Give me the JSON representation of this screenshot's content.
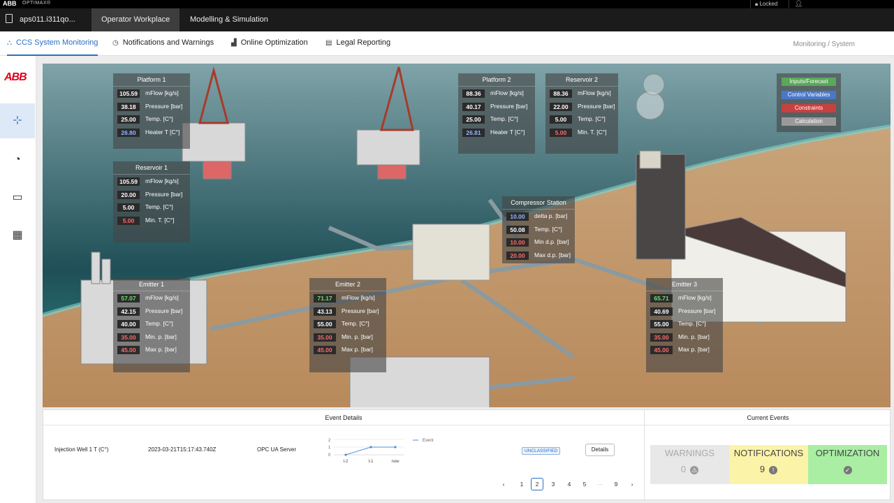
{
  "topbar": {
    "brand": "ABB",
    "app": "OPTIMAX®",
    "lock_label": "Locked"
  },
  "nav": {
    "doc_label": "aps011.i311qo...",
    "items": [
      "Operator Workplace",
      "Modelling & Simulation"
    ]
  },
  "tabs": [
    "CCS System Monitoring",
    "Notifications and Warnings",
    "Online Optimization",
    "Legal Reporting"
  ],
  "breadcrumb": "Monitoring  /  System",
  "sidebar": {
    "logo": "ABB",
    "icons": [
      "network-icon",
      "pie-chart-icon",
      "monitor-icon",
      "grid-icon"
    ]
  },
  "legend": [
    "Inputs/Forecast",
    "Control Variables",
    "Constraints",
    "Calculation"
  ],
  "legend_colors": [
    "#5aa85a",
    "#4a78c8",
    "#c84040",
    "#9a9a9a"
  ],
  "panels": {
    "platform1": {
      "title": "Platform 1",
      "rows": [
        [
          "105.59",
          "mFlow [kg/s]",
          ""
        ],
        [
          "38.18",
          "Pressure [bar]",
          ""
        ],
        [
          "25.00",
          "Temp. [C°]",
          ""
        ],
        [
          "26.80",
          "Heater T [C°]",
          "blue"
        ]
      ]
    },
    "reservoir1": {
      "title": "Reservoir 1",
      "rows": [
        [
          "105.59",
          "mFlow [kg/s]",
          ""
        ],
        [
          "20.00",
          "Pressure [bar]",
          ""
        ],
        [
          "5.00",
          "Temp. [C°]",
          ""
        ],
        [
          "5.00",
          "Min. T. [C°]",
          "red"
        ]
      ]
    },
    "platform2": {
      "title": "Platform 2",
      "rows": [
        [
          "88.36",
          "mFlow [kg/s]",
          ""
        ],
        [
          "40.17",
          "Pressure [bar]",
          ""
        ],
        [
          "25.00",
          "Temp. [C°]",
          ""
        ],
        [
          "26.81",
          "Heater T [C°]",
          "blue"
        ]
      ]
    },
    "reservoir2": {
      "title": "Reservoir 2",
      "rows": [
        [
          "88.36",
          "mFlow [kg/s]",
          ""
        ],
        [
          "22.00",
          "Pressure [bar]",
          ""
        ],
        [
          "5.00",
          "Temp. [C°]",
          ""
        ],
        [
          "5.00",
          "Min. T. [C°]",
          "red"
        ]
      ]
    },
    "compressor": {
      "title": "Compressor Station",
      "rows": [
        [
          "10.00",
          "delta p. [bar]",
          "blue"
        ],
        [
          "50.08",
          "Temp. [C°]",
          ""
        ],
        [
          "10.00",
          "Min d.p. [bar]",
          "red"
        ],
        [
          "20.00",
          "Max d.p. [bar]",
          "red"
        ]
      ]
    },
    "emitter1": {
      "title": "Emitter 1",
      "rows": [
        [
          "57.07",
          "mFlow [kg/s]",
          "green"
        ],
        [
          "42.15",
          "Pressure [bar]",
          ""
        ],
        [
          "40.00",
          "Temp. [C°]",
          ""
        ],
        [
          "35.00",
          "Min. p. [bar]",
          "red"
        ],
        [
          "45.00",
          "Max p. [bar]",
          "red"
        ]
      ]
    },
    "emitter2": {
      "title": "Emitter 2",
      "rows": [
        [
          "71.17",
          "mFlow [kg/s]",
          "green"
        ],
        [
          "43.13",
          "Pressure [bar]",
          ""
        ],
        [
          "55.00",
          "Temp. [C°]",
          ""
        ],
        [
          "35.00",
          "Min. p. [bar]",
          "red"
        ],
        [
          "45.00",
          "Max p. [bar]",
          "red"
        ]
      ]
    },
    "emitter3": {
      "title": "Emitter 3",
      "rows": [
        [
          "65.71",
          "mFlow [kg/s]",
          "green"
        ],
        [
          "40.69",
          "Pressure [bar]",
          ""
        ],
        [
          "55.00",
          "Temp. [C°]",
          ""
        ],
        [
          "35.00",
          "Min. p. [bar]",
          "red"
        ],
        [
          "45.00",
          "Max p. [bar]",
          "red"
        ]
      ]
    }
  },
  "event_details": {
    "title": "Event Details",
    "name": "Injection Well 1 T (C°)",
    "timestamp": "2023-03-21T15:17:43.740Z",
    "source": "OPC UA Server",
    "classification": "UNCLASSIFIED",
    "details_label": "Details",
    "mini_chart": {
      "legend": "Event",
      "x": [
        "t-2",
        "t-1",
        "now"
      ],
      "y_ticks": [
        "2",
        "1",
        "0"
      ],
      "values": [
        0,
        1,
        1
      ]
    }
  },
  "pager": {
    "prev": "‹",
    "next": "›",
    "pages": [
      "1",
      "2",
      "3",
      "4",
      "5",
      "···",
      "9"
    ],
    "current": "2"
  },
  "current_events": {
    "title": "Current Events",
    "cards": [
      {
        "label": "WARNINGS",
        "count": "0",
        "glyph": "⚠"
      },
      {
        "label": "NOTIFICATIONS",
        "count": "9",
        "glyph": "!"
      },
      {
        "label": "OPTIMIZATION",
        "count": "",
        "glyph": "✓"
      }
    ]
  }
}
